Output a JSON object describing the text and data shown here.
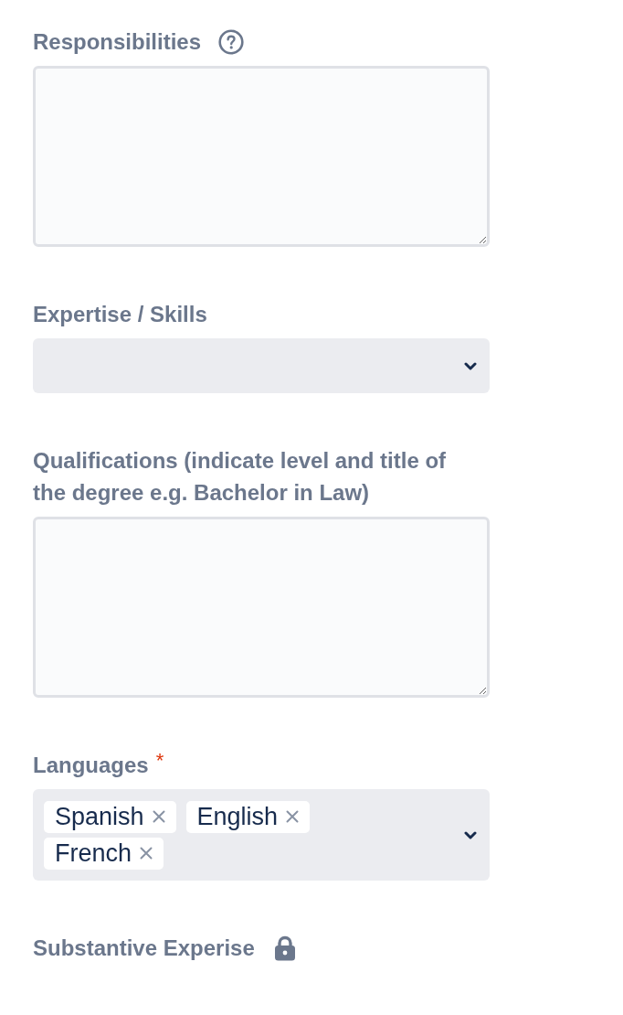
{
  "fields": [
    {
      "kind": "textarea",
      "label": "Responsibilities",
      "help": true,
      "locked": false
    },
    {
      "kind": "select",
      "label": "Expertise / Skills",
      "help": false,
      "locked": false
    },
    {
      "kind": "textarea",
      "label": "Qualifications (indicate level and title of the degree e.g. Bachelor in Law)",
      "help": false,
      "locked": false
    },
    {
      "kind": "multiselect",
      "label": "Languages",
      "required_mark": "*",
      "help": false,
      "locked": false,
      "values": [
        "Spanish",
        "English",
        "French"
      ]
    },
    {
      "kind": "heading",
      "label": "Substantive Experise",
      "help": false,
      "locked": true
    }
  ]
}
